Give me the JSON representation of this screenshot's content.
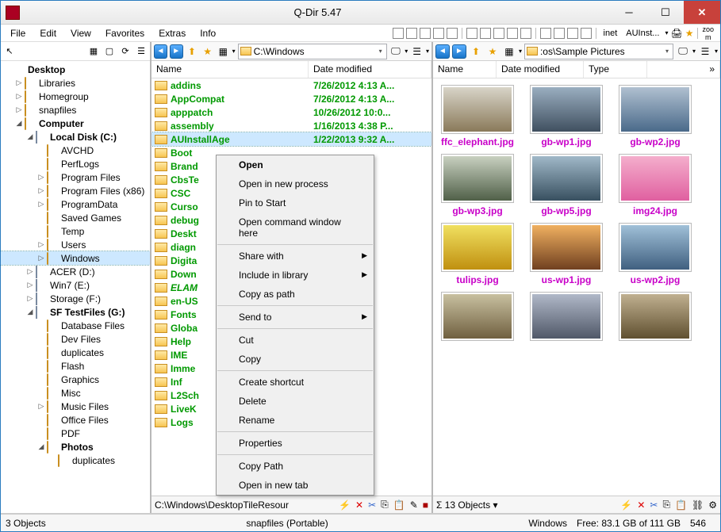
{
  "window": {
    "title": "Q-Dir 5.47"
  },
  "menu": [
    "File",
    "Edit",
    "View",
    "Favorites",
    "Extras",
    "Info"
  ],
  "toolbar_dropdown": "AUInst...",
  "sidebar": {
    "tree": [
      {
        "i": 0,
        "tw": "",
        "ic": "desk",
        "bold": true,
        "label": "Desktop"
      },
      {
        "i": 1,
        "tw": "▷",
        "ic": "lib",
        "label": "Libraries"
      },
      {
        "i": 1,
        "tw": "▷",
        "ic": "hg",
        "label": "Homegroup"
      },
      {
        "i": 1,
        "tw": "▷",
        "ic": "fld",
        "label": "snapfiles"
      },
      {
        "i": 1,
        "tw": "◢",
        "ic": "pc",
        "bold": true,
        "label": "Computer"
      },
      {
        "i": 2,
        "tw": "◢",
        "ic": "drv",
        "bold": true,
        "label": "Local Disk (C:)"
      },
      {
        "i": 3,
        "tw": "",
        "ic": "fld",
        "label": "AVCHD"
      },
      {
        "i": 3,
        "tw": "",
        "ic": "fld",
        "label": "PerfLogs"
      },
      {
        "i": 3,
        "tw": "▷",
        "ic": "fld",
        "label": "Program Files"
      },
      {
        "i": 3,
        "tw": "▷",
        "ic": "fld",
        "label": "Program Files (x86)"
      },
      {
        "i": 3,
        "tw": "▷",
        "ic": "fld",
        "label": "ProgramData"
      },
      {
        "i": 3,
        "tw": "",
        "ic": "fld",
        "label": "Saved Games"
      },
      {
        "i": 3,
        "tw": "",
        "ic": "fld",
        "label": "Temp"
      },
      {
        "i": 3,
        "tw": "▷",
        "ic": "fld",
        "label": "Users"
      },
      {
        "i": 3,
        "tw": "▷",
        "ic": "fld",
        "sel": true,
        "label": "Windows"
      },
      {
        "i": 2,
        "tw": "▷",
        "ic": "drv",
        "label": "ACER (D:)"
      },
      {
        "i": 2,
        "tw": "▷",
        "ic": "drv",
        "label": "Win7 (E:)"
      },
      {
        "i": 2,
        "tw": "▷",
        "ic": "drv",
        "label": "Storage (F:)"
      },
      {
        "i": 2,
        "tw": "◢",
        "ic": "drv",
        "bold": true,
        "label": "SF TestFiles (G:)"
      },
      {
        "i": 3,
        "tw": "",
        "ic": "fld",
        "label": "Database Files"
      },
      {
        "i": 3,
        "tw": "",
        "ic": "fld",
        "label": "Dev Files"
      },
      {
        "i": 3,
        "tw": "",
        "ic": "fld",
        "label": "duplicates"
      },
      {
        "i": 3,
        "tw": "",
        "ic": "fld",
        "label": "Flash"
      },
      {
        "i": 3,
        "tw": "",
        "ic": "fld",
        "label": "Graphics"
      },
      {
        "i": 3,
        "tw": "",
        "ic": "fld",
        "label": "Misc"
      },
      {
        "i": 3,
        "tw": "▷",
        "ic": "fld",
        "label": "Music Files"
      },
      {
        "i": 3,
        "tw": "",
        "ic": "fld",
        "label": "Office Files"
      },
      {
        "i": 3,
        "tw": "",
        "ic": "fld",
        "label": "PDF"
      },
      {
        "i": 3,
        "tw": "◢",
        "ic": "fld",
        "bold": true,
        "label": "Photos"
      },
      {
        "i": 4,
        "tw": "",
        "ic": "fld",
        "label": "duplicates"
      }
    ]
  },
  "pane_left": {
    "path": "C:\\Windows",
    "cols": [
      "Name",
      "Date modified"
    ],
    "rows": [
      {
        "n": "addins",
        "d": "7/26/2012 4:13 A..."
      },
      {
        "n": "AppCompat",
        "d": "7/26/2012 4:13 A..."
      },
      {
        "n": "apppatch",
        "d": "10/26/2012 10:0..."
      },
      {
        "n": "assembly",
        "d": "1/16/2013 4:38 P..."
      },
      {
        "n": "AUInstallAge",
        "d": "1/22/2013 9:32 A...",
        "sel": true
      },
      {
        "n": "Boot",
        "d": ""
      },
      {
        "n": "Brand",
        "d": ""
      },
      {
        "n": "CbsTe",
        "d": ""
      },
      {
        "n": "CSC",
        "d": ""
      },
      {
        "n": "Curso",
        "d": ""
      },
      {
        "n": "debug",
        "d": ""
      },
      {
        "n": "Deskt",
        "d": ""
      },
      {
        "n": "diagn",
        "d": ""
      },
      {
        "n": "Digita",
        "d": ""
      },
      {
        "n": "Down",
        "d": ""
      },
      {
        "n": "ELAM",
        "d": "",
        "italic": true
      },
      {
        "n": "en-US",
        "d": ""
      },
      {
        "n": "Fonts",
        "d": ""
      },
      {
        "n": "Globa",
        "d": ""
      },
      {
        "n": "Help",
        "d": ""
      },
      {
        "n": "IME",
        "d": ""
      },
      {
        "n": "Imme",
        "d": ""
      },
      {
        "n": "Inf",
        "d": ""
      },
      {
        "n": "L2Sch",
        "d": ""
      },
      {
        "n": "LiveK",
        "d": ""
      },
      {
        "n": "Logs",
        "d": ""
      }
    ],
    "status_path": "C:\\Windows\\DesktopTileResour"
  },
  "pane_right": {
    "path": ":os\\Sample Pictures",
    "cols": [
      "Name",
      "Date modified",
      "Type"
    ],
    "thumbs": [
      {
        "cap": "ffc_elephant.jpg",
        "g": [
          "#d8d4c8",
          "#8a7a5a"
        ]
      },
      {
        "cap": "gb-wp1.jpg",
        "g": [
          "#9aaec0",
          "#405060"
        ]
      },
      {
        "cap": "gb-wp2.jpg",
        "g": [
          "#b0c0d0",
          "#4a6a8a"
        ]
      },
      {
        "cap": "gb-wp3.jpg",
        "g": [
          "#c8d0c0",
          "#506048"
        ]
      },
      {
        "cap": "gb-wp5.jpg",
        "g": [
          "#a0b8c8",
          "#385060"
        ]
      },
      {
        "cap": "img24.jpg",
        "g": [
          "#f4aecc",
          "#e060a0"
        ]
      },
      {
        "cap": "tulips.jpg",
        "g": [
          "#f0e060",
          "#c09010"
        ]
      },
      {
        "cap": "us-wp1.jpg",
        "g": [
          "#f0b060",
          "#704020"
        ]
      },
      {
        "cap": "us-wp2.jpg",
        "g": [
          "#a0c0d8",
          "#406080"
        ]
      },
      {
        "cap": "",
        "g": [
          "#c8c0a0",
          "#706040"
        ]
      },
      {
        "cap": "",
        "g": [
          "#b0b8c8",
          "#505868"
        ]
      },
      {
        "cap": "",
        "g": [
          "#c0b090",
          "#605030"
        ]
      }
    ],
    "status": "Σ  13 Objects  ▾"
  },
  "context_menu": [
    {
      "t": "Open",
      "bold": true
    },
    {
      "t": "Open in new process"
    },
    {
      "t": "Pin to Start"
    },
    {
      "t": "Open command window here"
    },
    {
      "sep": true
    },
    {
      "t": "Share with",
      "sub": true
    },
    {
      "t": "Include in library",
      "sub": true
    },
    {
      "t": "Copy as path"
    },
    {
      "sep": true
    },
    {
      "t": "Send to",
      "sub": true
    },
    {
      "sep": true
    },
    {
      "t": "Cut"
    },
    {
      "t": "Copy"
    },
    {
      "sep": true
    },
    {
      "t": "Create shortcut"
    },
    {
      "t": "Delete"
    },
    {
      "t": "Rename"
    },
    {
      "sep": true
    },
    {
      "t": "Properties"
    },
    {
      "sep": true
    },
    {
      "t": "Copy Path"
    },
    {
      "t": "Open in new tab"
    }
  ],
  "status": {
    "left": "3 Objects",
    "mid": "snapfiles (Portable)",
    "r1": "Windows",
    "r2": "Free: 83.1 GB of 111 GB",
    "r3": "546"
  }
}
